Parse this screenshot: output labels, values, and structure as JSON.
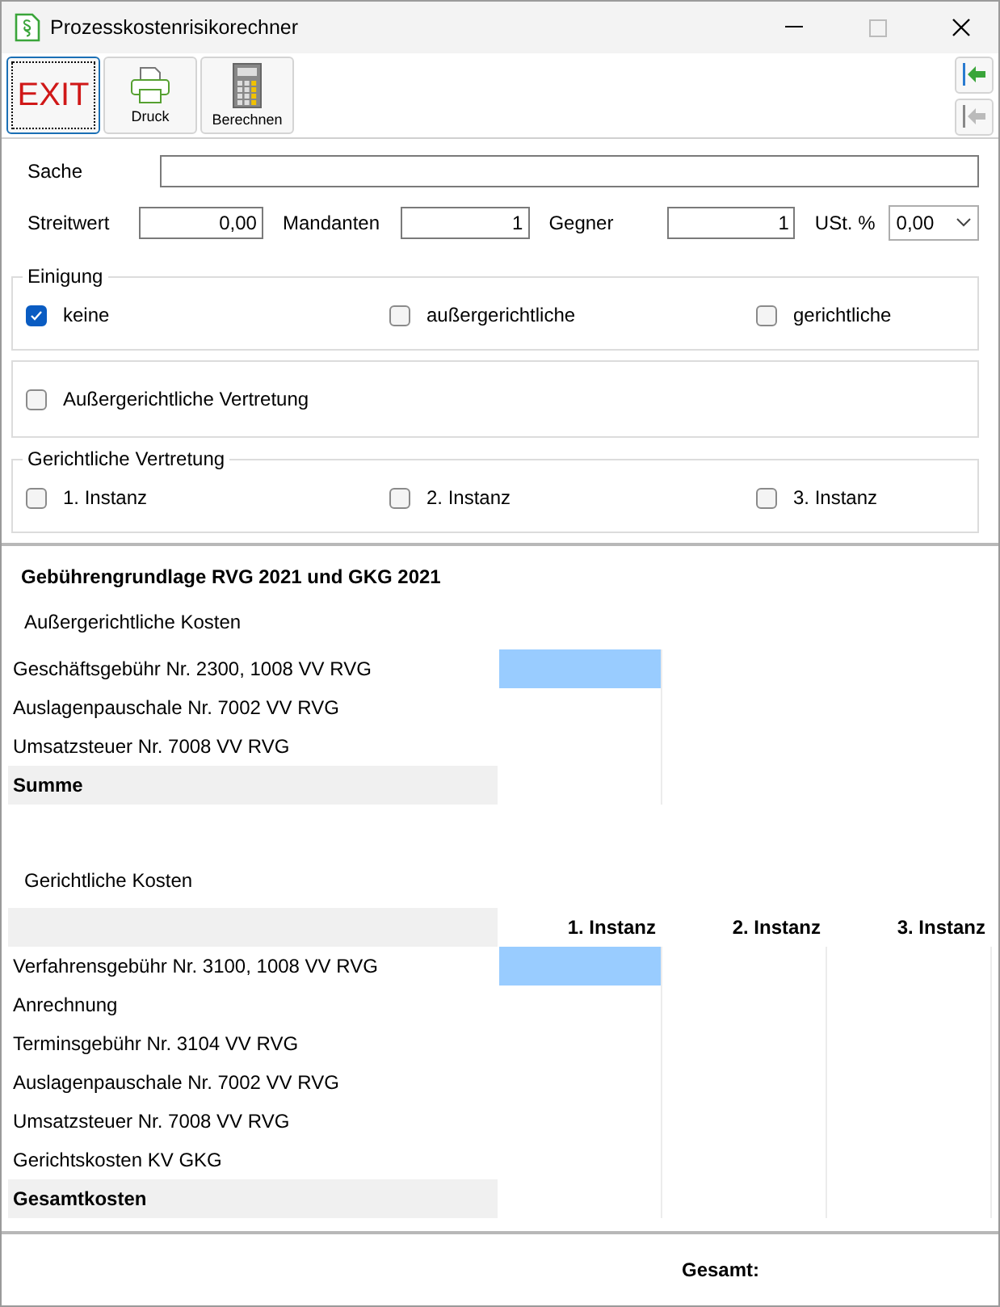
{
  "window": {
    "title": "Prozesskostenrisikorechner"
  },
  "toolbar": {
    "buttons": [
      {
        "label": "EXIT",
        "kind": "exit",
        "focused": true
      },
      {
        "label": "Druck",
        "kind": "print",
        "focused": false
      },
      {
        "label": "Berechnen",
        "kind": "calc",
        "focused": false
      }
    ]
  },
  "form": {
    "sache": {
      "label": "Sache"
    },
    "fields": [
      {
        "label": "Streitwert",
        "value": "0,00",
        "kind": "input"
      },
      {
        "label": "Mandanten",
        "value": "1",
        "kind": "input"
      },
      {
        "label": "Gegner",
        "value": "1",
        "kind": "input"
      },
      {
        "label": "USt. %",
        "value": "0,00",
        "kind": "select"
      }
    ]
  },
  "einigung": {
    "title": "Einigung",
    "options": [
      {
        "label": "keine",
        "checked": true
      },
      {
        "label": "außergerichtliche",
        "checked": false
      },
      {
        "label": "gerichtliche",
        "checked": false
      }
    ]
  },
  "aussergerichtliche_vertretung": {
    "label": "Außergerichtliche Vertretung",
    "checked": false
  },
  "gerichtliche_vertretung": {
    "title": "Gerichtliche Vertretung",
    "options": [
      {
        "label": "1. Instanz",
        "checked": false
      },
      {
        "label": "2. Instanz",
        "checked": false
      },
      {
        "label": "3. Instanz",
        "checked": false
      }
    ]
  },
  "fees": {
    "title": "Gebührengrundlage RVG 2021 und GKG 2021",
    "sections": [
      {
        "title": "Außergerichtliche Kosten",
        "rows": [
          {
            "label": "Geschäftsgebühr Nr. 2300, 1008 VV RVG",
            "kind": "item",
            "selected": true
          },
          {
            "label": "Auslagenpauschale Nr. 7002 VV RVG",
            "kind": "item",
            "selected": false
          },
          {
            "label": "Umsatzsteuer Nr. 7008 VV RVG",
            "kind": "item",
            "selected": false
          },
          {
            "label": "Summe",
            "kind": "total",
            "selected": false
          }
        ]
      },
      {
        "title": "Gerichtliche Kosten",
        "columns": [
          "1. Instanz",
          "2. Instanz",
          "3. Instanz"
        ],
        "rows": [
          {
            "label": "Verfahrensgebühr Nr. 3100, 1008 VV RVG",
            "kind": "item",
            "selected": true
          },
          {
            "label": "Anrechnung",
            "kind": "item",
            "selected": false
          },
          {
            "label": "Terminsgebühr Nr. 3104 VV RVG",
            "kind": "item",
            "selected": false
          },
          {
            "label": "Auslagenpauschale Nr. 7002 VV RVG",
            "kind": "item",
            "selected": false
          },
          {
            "label": "Umsatzsteuer Nr. 7008 VV RVG",
            "kind": "item",
            "selected": false
          },
          {
            "label": "Gerichtskosten KV GKG",
            "kind": "item",
            "selected": false
          },
          {
            "label": "Gesamtkosten",
            "kind": "total",
            "selected": false
          }
        ]
      }
    ]
  },
  "footer": {
    "label": "Gesamt:"
  }
}
